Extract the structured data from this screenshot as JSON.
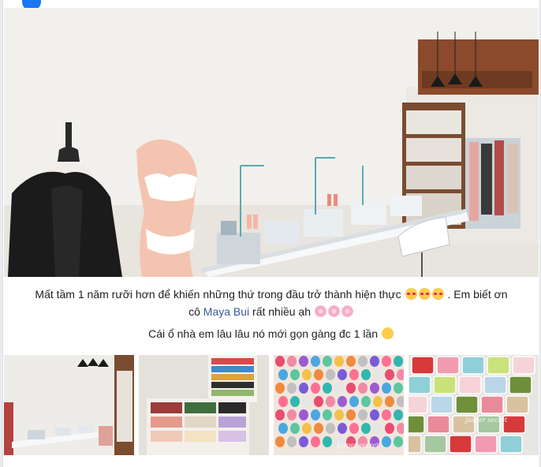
{
  "post": {
    "caption_line1_before": "Mất tầm 1 năm rưỡi hơn để khiến những thứ trong đầu trở thành hiện thực ",
    "caption_line1_after": " . Em biết ơn",
    "caption_line2_before": "cô ",
    "mention": "Maya Bui",
    "caption_line2_after": " rất nhiều ạh ",
    "caption_line3": "Cái ổ nhà em lâu lâu nó mới gọn gàng đc 1 lần ",
    "emoji": {
      "love": "smiling-face-with-hearts-icon",
      "flower": "cherry-blossom-icon",
      "laugh": "rofl-icon"
    }
  },
  "photos": {
    "watermark_3": "Jasper secret",
    "watermark_4": "Jasper secret"
  },
  "colors": {
    "link": "#385898",
    "text": "#1c1e21",
    "background": "#e9ebee"
  }
}
